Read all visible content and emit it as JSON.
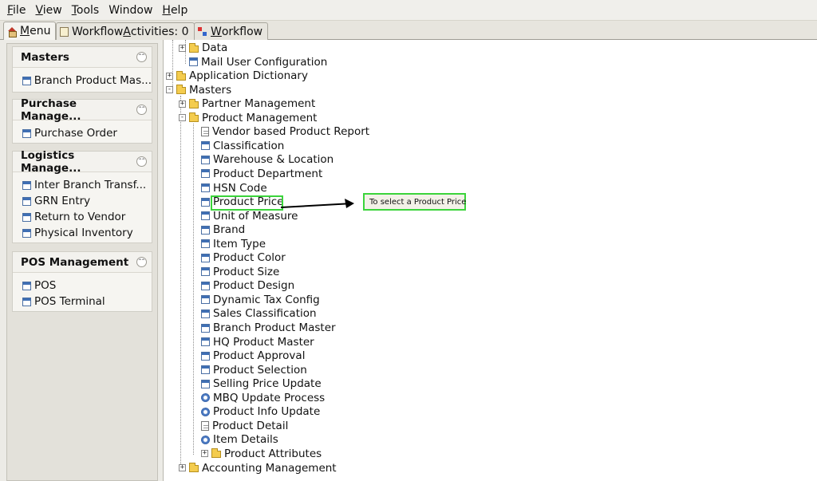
{
  "menubar": {
    "items": [
      {
        "label": "File",
        "mnemonic": "F",
        "rest": "ile"
      },
      {
        "label": "View",
        "mnemonic": "V",
        "rest": "iew"
      },
      {
        "label": "Tools",
        "mnemonic": "T",
        "rest": "ools"
      },
      {
        "label": "Window",
        "mnemonic": "",
        "rest": "Window"
      },
      {
        "label": "Help",
        "mnemonic": "H",
        "rest": "elp"
      }
    ]
  },
  "tabs": {
    "menu": {
      "mnemonic": "M",
      "rest": "enu",
      "icon": "home-icon"
    },
    "workflow_activities": {
      "pre": "Workflow ",
      "mnemonic": "A",
      "rest": "ctivities: 0",
      "icon": "workflow-activities-icon"
    },
    "workflow": {
      "mnemonic": "W",
      "rest": "orkflow",
      "icon": "workflow-icon"
    }
  },
  "left_panel": {
    "groups": [
      {
        "title": "Masters",
        "items": [
          "Branch Product Mas..."
        ]
      },
      {
        "title": "Purchase Manage...",
        "items": [
          "Purchase Order"
        ]
      },
      {
        "title": "Logistics Manage...",
        "items": [
          "Inter Branch Transf...",
          "GRN Entry",
          "Return to Vendor",
          "Physical Inventory"
        ]
      },
      {
        "title": "POS Management",
        "items": [
          "POS",
          "POS Terminal"
        ]
      }
    ],
    "collapse_glyph": "«"
  },
  "tree": {
    "nodes": [
      {
        "label": "Data",
        "icon": "folder-icon",
        "toggle": "+"
      },
      {
        "label": "Mail User Configuration",
        "icon": "window-icon",
        "toggle": ""
      },
      {
        "label": "Application Dictionary",
        "icon": "folder-icon",
        "toggle": "+"
      },
      {
        "label": "Masters",
        "icon": "folder-open-icon",
        "toggle": "-"
      },
      {
        "label": "Partner Management",
        "icon": "folder-icon",
        "toggle": "+"
      },
      {
        "label": "Product Management",
        "icon": "folder-open-icon",
        "toggle": "-"
      },
      {
        "label": "Vendor based Product Report",
        "icon": "report-icon",
        "toggle": ""
      },
      {
        "label": "Classification",
        "icon": "window-icon",
        "toggle": ""
      },
      {
        "label": "Warehouse & Location",
        "icon": "window-icon",
        "toggle": ""
      },
      {
        "label": "Product Department",
        "icon": "window-icon",
        "toggle": ""
      },
      {
        "label": "HSN Code",
        "icon": "window-icon",
        "toggle": ""
      },
      {
        "label": "Product Price",
        "icon": "window-icon",
        "toggle": ""
      },
      {
        "label": "Unit of Measure",
        "icon": "window-icon",
        "toggle": ""
      },
      {
        "label": "Brand",
        "icon": "window-icon",
        "toggle": ""
      },
      {
        "label": "Item Type",
        "icon": "window-icon",
        "toggle": ""
      },
      {
        "label": "Product Color",
        "icon": "window-icon",
        "toggle": ""
      },
      {
        "label": "Product Size",
        "icon": "window-icon",
        "toggle": ""
      },
      {
        "label": "Product Design",
        "icon": "window-icon",
        "toggle": ""
      },
      {
        "label": "Dynamic Tax Config",
        "icon": "window-icon",
        "toggle": ""
      },
      {
        "label": "Sales Classification",
        "icon": "window-icon",
        "toggle": ""
      },
      {
        "label": "Branch Product Master",
        "icon": "window-icon",
        "toggle": ""
      },
      {
        "label": "HQ Product Master",
        "icon": "window-icon",
        "toggle": ""
      },
      {
        "label": "Product Approval",
        "icon": "window-icon",
        "toggle": ""
      },
      {
        "label": "Product Selection",
        "icon": "window-icon",
        "toggle": ""
      },
      {
        "label": "Selling Price Update",
        "icon": "window-icon",
        "toggle": ""
      },
      {
        "label": "MBQ Update Process",
        "icon": "process-gear-icon",
        "toggle": ""
      },
      {
        "label": "Product Info Update",
        "icon": "process-gear-icon",
        "toggle": ""
      },
      {
        "label": "Product Detail",
        "icon": "report-icon",
        "toggle": ""
      },
      {
        "label": "Item Details",
        "icon": "process-gear-icon",
        "toggle": ""
      },
      {
        "label": "Product Attributes",
        "icon": "folder-icon",
        "toggle": "+"
      },
      {
        "label": "Accounting Management",
        "icon": "folder-icon",
        "toggle": "+"
      }
    ]
  },
  "annotation": {
    "callout_text": "To select a Product Price",
    "highlight_color": "#3bd43b"
  }
}
